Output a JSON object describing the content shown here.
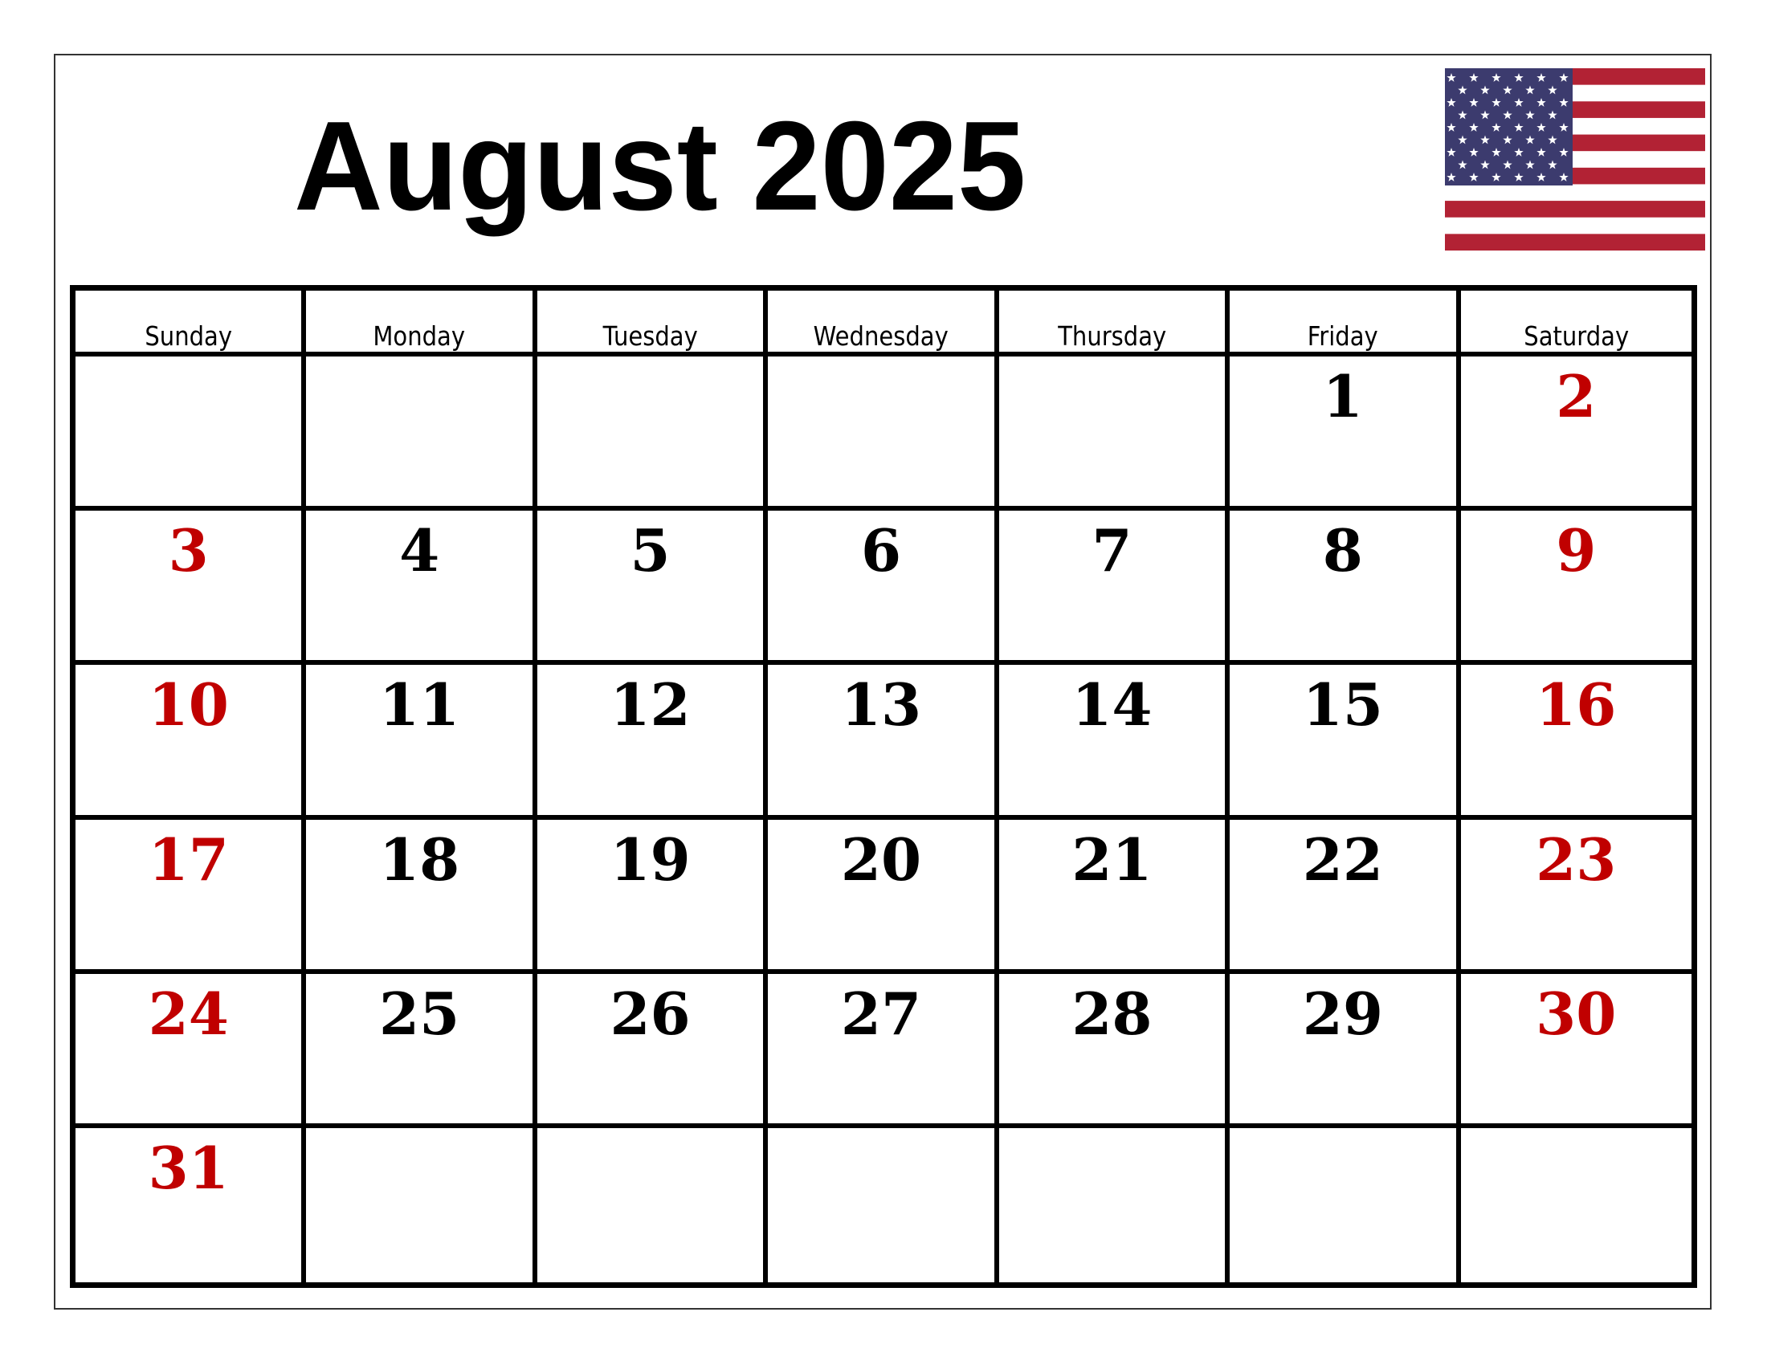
{
  "title": "August 2025",
  "flag": {
    "icon": "us-flag-icon",
    "colors": {
      "blue": "#3c3b6e",
      "red": "#b22234",
      "white": "#ffffff"
    }
  },
  "weekdays": [
    "Sunday",
    "Monday",
    "Tuesday",
    "Wednesday",
    "Thursday",
    "Friday",
    "Saturday"
  ],
  "weekend_color": "#c00000",
  "weeks": [
    [
      "",
      "",
      "",
      "",
      "",
      "1",
      "2"
    ],
    [
      "3",
      "4",
      "5",
      "6",
      "7",
      "8",
      "9"
    ],
    [
      "10",
      "11",
      "12",
      "13",
      "14",
      "15",
      "16"
    ],
    [
      "17",
      "18",
      "19",
      "20",
      "21",
      "22",
      "23"
    ],
    [
      "24",
      "25",
      "26",
      "27",
      "28",
      "29",
      "30"
    ],
    [
      "31",
      "",
      "",
      "",
      "",
      "",
      ""
    ]
  ]
}
